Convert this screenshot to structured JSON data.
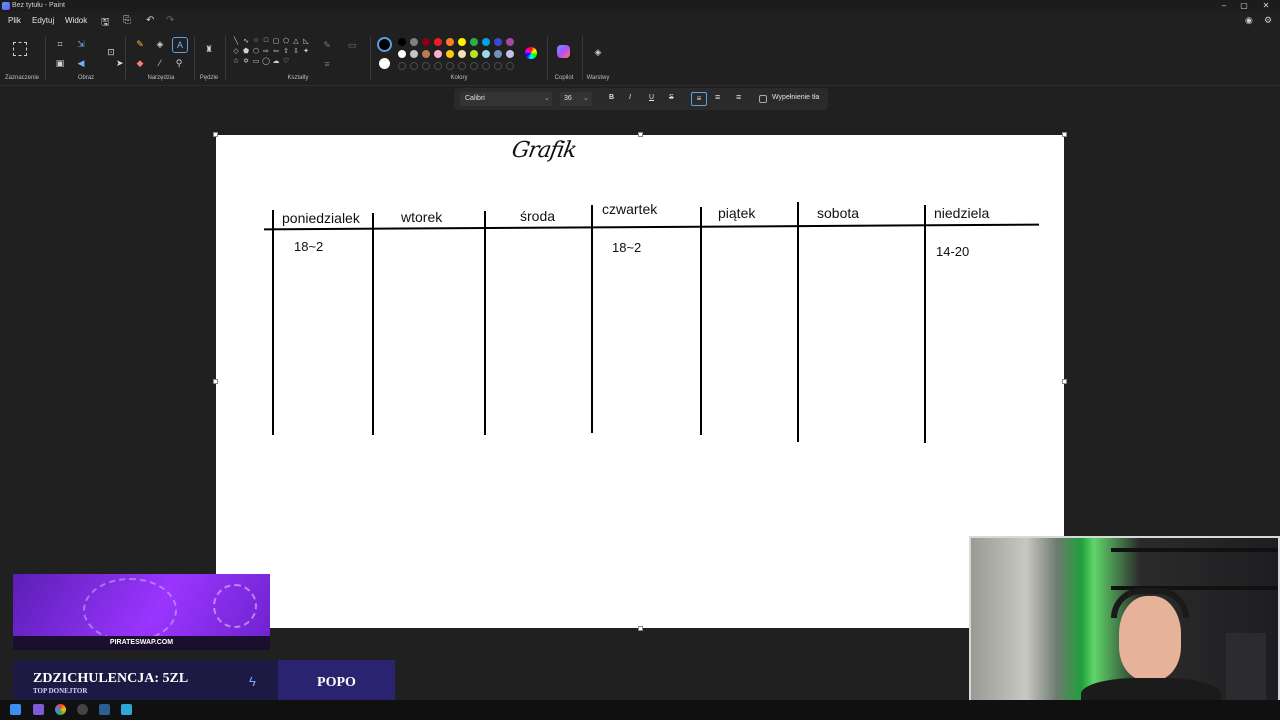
{
  "window": {
    "title": "Bez tytułu - Paint",
    "controls": [
      "–",
      "▢",
      "✕"
    ]
  },
  "menu": {
    "items": [
      "Plik",
      "Edytuj",
      "Widok"
    ]
  },
  "ribbon": {
    "groups": [
      "Zaznaczenie",
      "Obraz",
      "Narzędzia",
      "Pędzle",
      "Kształty",
      "Kolory",
      "Copilot",
      "Warstwy"
    ]
  },
  "text_toolbar": {
    "font": "Calibri",
    "size": "36",
    "bold": "B",
    "italic": "I",
    "underline": "U",
    "strike": "S",
    "fill_label": "Wypełnienie tła"
  },
  "colors": {
    "row1": [
      "#000000",
      "#7f7f7f",
      "#880015",
      "#ed1c24",
      "#ff7f27",
      "#fff200",
      "#22b14c",
      "#00a2e8",
      "#3f48cc",
      "#a349a4"
    ],
    "row2": [
      "#ffffff",
      "#c3c3c3",
      "#b97a57",
      "#ffaec9",
      "#ffc90e",
      "#efe4b0",
      "#b5e61d",
      "#99d9ea",
      "#7092be",
      "#c8bfe7"
    ]
  },
  "canvas": {
    "heading": "Grafik",
    "days": [
      "poniedzialek",
      "wtorek",
      "środa",
      "czwartek",
      "piątek",
      "sobota",
      "niedziela"
    ],
    "entries": {
      "poniedzialek": "18~2",
      "czwartek": "18~2",
      "niedziela": "14-20"
    }
  },
  "overlay": {
    "banner_site": "PIRATESWAP.COM",
    "donor_name": "ZDZICHULENCJA: 5ZL",
    "donor_sub": "TOP DONEJTOR",
    "right_label": "POPO"
  }
}
